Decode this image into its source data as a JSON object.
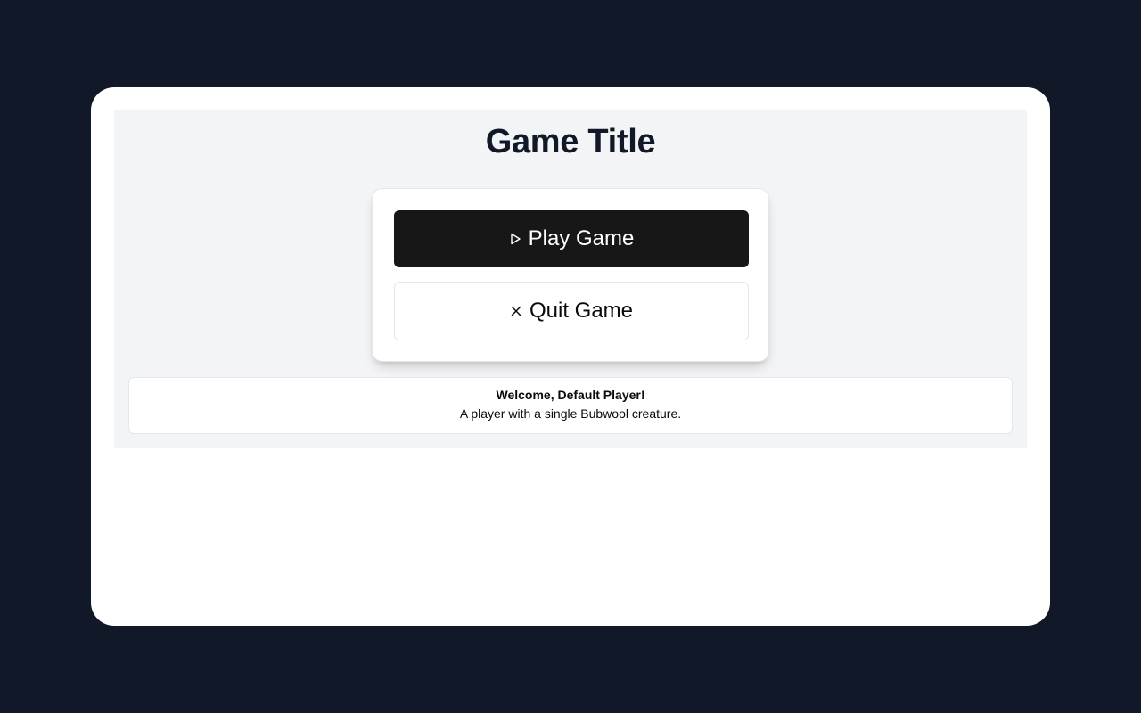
{
  "game": {
    "title": "Game Title"
  },
  "menu": {
    "play_label": "Play Game",
    "play_icon": "play-icon",
    "quit_label": "Quit Game",
    "quit_icon": "close-icon"
  },
  "player": {
    "greeting": "Welcome, Default Player!",
    "description": "A player with a single Bubwool creature."
  },
  "colors": {
    "backdrop": "#111827",
    "panel": "#f3f4f6",
    "primary_button": "#171717",
    "title_text": "#111827"
  }
}
